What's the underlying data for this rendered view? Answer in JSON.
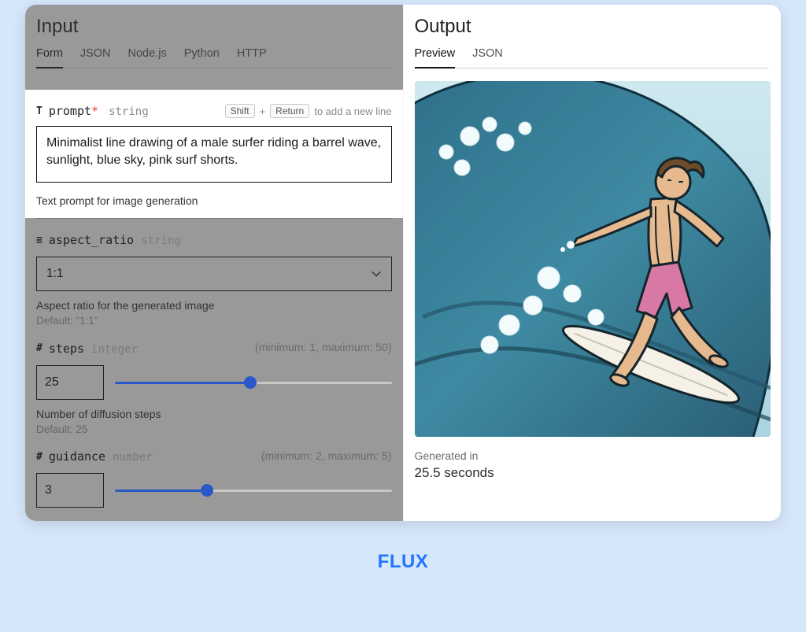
{
  "brand": "FLUX",
  "input": {
    "title": "Input",
    "tabs": [
      "Form",
      "JSON",
      "Node.js",
      "Python",
      "HTTP"
    ],
    "active_tab": 0,
    "prompt": {
      "icon": "T",
      "name": "prompt",
      "required_marker": "*",
      "type": "string",
      "hint_prefix_key1": "Shift",
      "hint_plus": "+",
      "hint_prefix_key2": "Return",
      "hint_text": "to add a new line",
      "value": "Minimalist line drawing of a male surfer riding a barrel wave, sunlight, blue sky, pink surf shorts.",
      "description": "Text prompt for image generation"
    },
    "aspect_ratio": {
      "icon": "≡",
      "name": "aspect_ratio",
      "type": "string",
      "value": "1:1",
      "description": "Aspect ratio for the generated image",
      "default_label": "Default: \"1:1\""
    },
    "steps": {
      "icon": "#",
      "name": "steps",
      "type": "integer",
      "range_text": "(minimum: 1, maximum: 50)",
      "value": "25",
      "min": 1,
      "max": 50,
      "num": 25,
      "description": "Number of diffusion steps",
      "default_label": "Default: 25"
    },
    "guidance": {
      "icon": "#",
      "name": "guidance",
      "type": "number",
      "range_text": "(minimum: 2, maximum: 5)",
      "value": "3",
      "min": 2,
      "max": 5,
      "num": 3
    }
  },
  "output": {
    "title": "Output",
    "tabs": [
      "Preview",
      "JSON"
    ],
    "active_tab": 0,
    "generated_label": "Generated in",
    "generated_time": "25.5 seconds"
  }
}
